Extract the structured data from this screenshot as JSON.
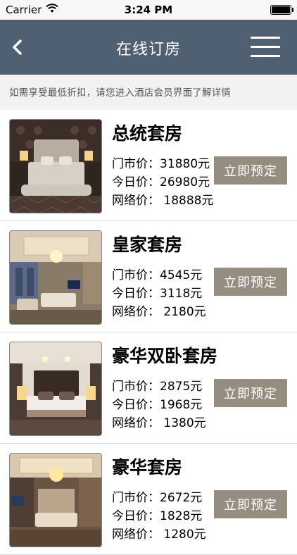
{
  "status_bar": {
    "carrier": "Carrier",
    "time": "3:24 PM",
    "battery_level": 1.0
  },
  "nav": {
    "title": "在线订房",
    "bg_color": "#4f6073"
  },
  "notice": "如需享受最低折扣，请您进入酒店会员界面了解详情",
  "rooms": [
    {
      "name": "总统套房",
      "market_price": "门市价：31880元",
      "today_price": "今日价：26980元",
      "online_price": "网络价： 18888元",
      "book_label": "立即预定"
    },
    {
      "name": "皇家套房",
      "market_price": "门市价：4545元",
      "today_price": "今日价：3118元",
      "online_price": "网络价： 2180元",
      "book_label": "立即预定"
    },
    {
      "name": "豪华双卧套房",
      "market_price": "门市价：2875元",
      "today_price": "今日价：1968元",
      "online_price": "网络价： 1380元",
      "book_label": "立即预定"
    },
    {
      "name": "豪华套房",
      "market_price": "门市价：2672元",
      "today_price": "今日价：1828元",
      "online_price": "网络价： 1280元",
      "book_label": "立即预定"
    }
  ],
  "colors": {
    "book_button": "#968d81",
    "notice_bg": "#f2f2f2"
  },
  "icons": {
    "back": "chevron-left-icon",
    "menu": "hamburger-menu-icon",
    "wifi": "wifi-icon",
    "battery": "battery-icon"
  }
}
